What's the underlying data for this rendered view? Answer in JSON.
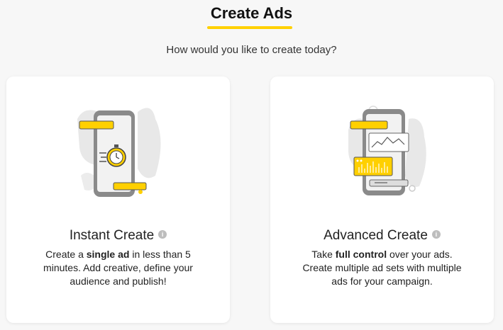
{
  "header": {
    "title": "Create Ads",
    "subtitle": "How would you like to create today?",
    "accent_color": "#ffd000"
  },
  "cards": [
    {
      "title": "Instant Create",
      "desc_pre": "Create a ",
      "desc_bold": "single ad",
      "desc_post": " in less than 5 minutes. Add creative, define your audience and publish!",
      "icon": "stopwatch-phone-illustration",
      "info_icon": "info-icon"
    },
    {
      "title": "Advanced Create",
      "desc_pre": "Take ",
      "desc_bold": "full control",
      "desc_post": " over your ads. Create multiple ad sets with multiple ads for your campaign.",
      "icon": "chart-phone-illustration",
      "info_icon": "info-icon"
    }
  ]
}
